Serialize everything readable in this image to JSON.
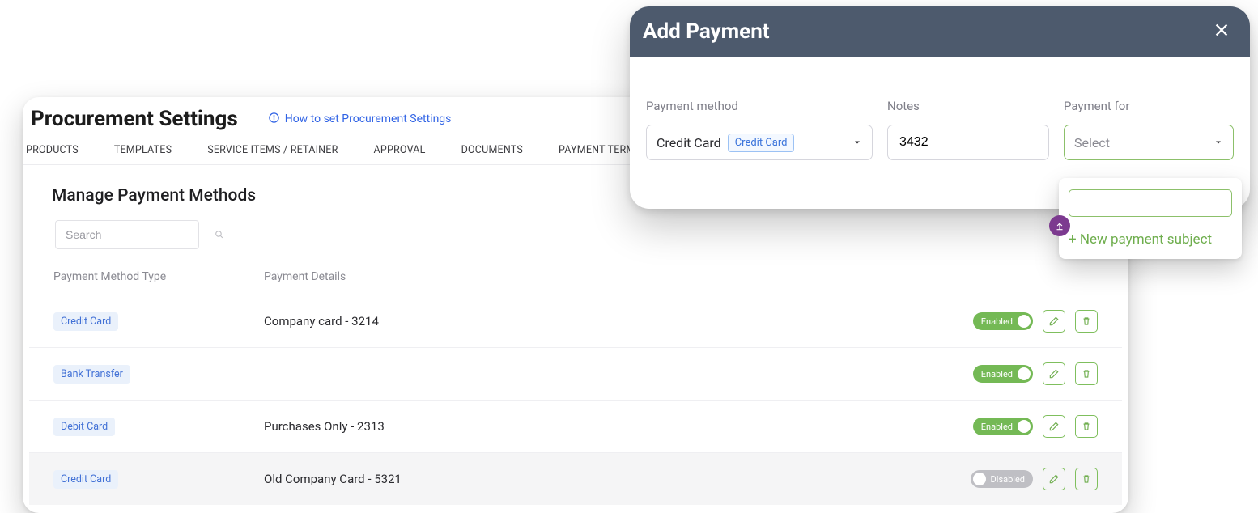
{
  "settings": {
    "title": "Procurement Settings",
    "help_link": "How to set Procurement Settings",
    "tabs": [
      "PRODUCTS",
      "TEMPLATES",
      "SERVICE ITEMS / RETAINER",
      "APPROVAL",
      "DOCUMENTS",
      "PAYMENT TERMS"
    ],
    "section_title": "Manage Payment Methods",
    "search_placeholder": "Search",
    "columns": {
      "type": "Payment Method Type",
      "details": "Payment Details"
    },
    "toggle_labels": {
      "enabled": "Enabled",
      "disabled": "Disabled"
    },
    "rows": [
      {
        "type": "Credit Card",
        "details": "Company card - 3214",
        "enabled": true
      },
      {
        "type": "Bank Transfer",
        "details": "",
        "enabled": true
      },
      {
        "type": "Debit Card",
        "details": "Purchases Only - 2313",
        "enabled": true
      },
      {
        "type": "Credit Card",
        "details": "Old Company Card - 5321",
        "enabled": false
      }
    ]
  },
  "modal": {
    "title": "Add Payment",
    "labels": {
      "payment_method": "Payment method",
      "notes": "Notes",
      "payment_for": "Payment for"
    },
    "payment_method": {
      "value": "Credit Card",
      "chip": "Credit Card"
    },
    "notes_value": "3432",
    "payment_for_placeholder": "Select",
    "dropdown": {
      "new_option_label": "+ New payment subject"
    }
  }
}
